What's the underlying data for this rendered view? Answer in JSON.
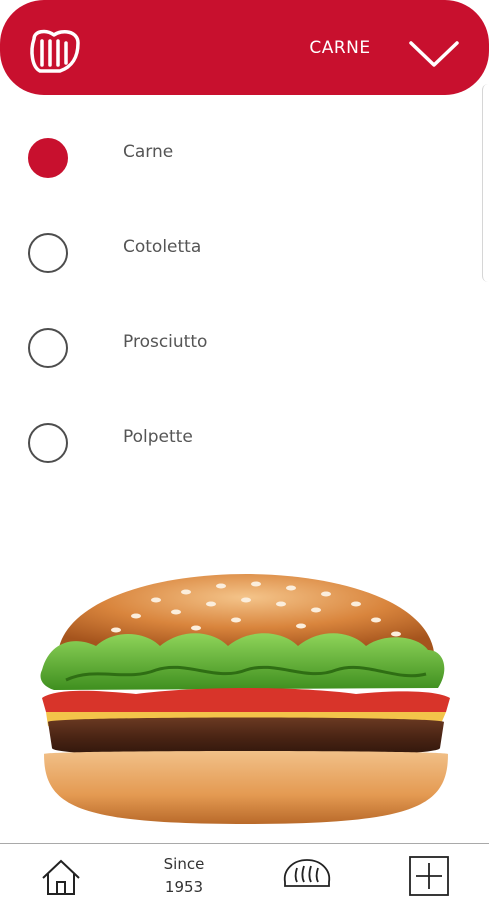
{
  "header": {
    "title": "CARNE",
    "logo_icon": "meat-steak-icon",
    "toggle_icon": "chevron-down-icon",
    "background_color": "#c8102e"
  },
  "options": [
    {
      "label": "Carne",
      "selected": true
    },
    {
      "label": "Cotoletta",
      "selected": false
    },
    {
      "label": "Prosciutto",
      "selected": false
    },
    {
      "label": "Polpette",
      "selected": false
    }
  ],
  "bottom_nav": {
    "home_icon": "home-icon",
    "since_line1": "Since",
    "since_line2": "1953",
    "bread_icon": "bread-icon",
    "add_icon": "plus-icon"
  }
}
